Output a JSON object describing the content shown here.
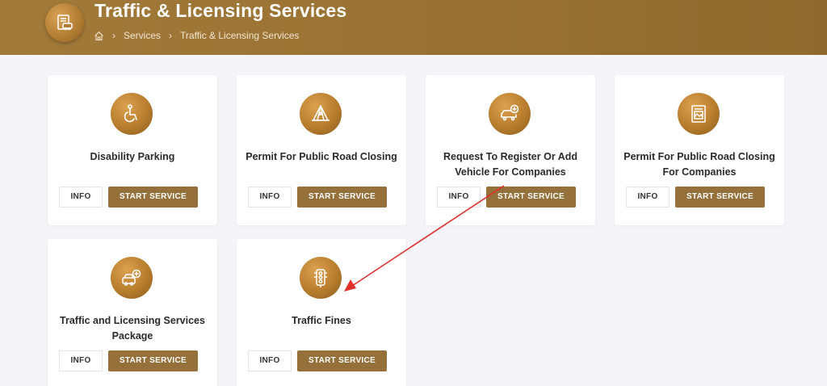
{
  "header": {
    "title": "Traffic & Licensing Services",
    "breadcrumb": {
      "home_icon": "home-icon",
      "items": [
        "Services",
        "Traffic & Licensing Services"
      ],
      "separator": "›"
    },
    "logo_icon": "document-car-icon"
  },
  "colors": {
    "banner": "#9a7233",
    "button": "#96703a",
    "icon_circle": "#b77d2d",
    "background": "#f5f4f8",
    "annotation_arrow": "#e0312a"
  },
  "services": [
    {
      "title": "Disability Parking",
      "icon": "wheelchair-icon",
      "info_label": "INFO",
      "start_label": "START SERVICE"
    },
    {
      "title": "Permit For Public Road Closing",
      "icon": "tent-icon",
      "info_label": "INFO",
      "start_label": "START SERVICE"
    },
    {
      "title": "Request To Register Or Add Vehicle For Companies",
      "icon": "car-add-icon",
      "info_label": "INFO",
      "start_label": "START SERVICE"
    },
    {
      "title": "Permit For Public Road Closing For Companies",
      "icon": "document-image-icon",
      "info_label": "INFO",
      "start_label": "START SERVICE"
    },
    {
      "title": "Traffic and Licensing Services Package",
      "icon": "car-package-icon",
      "info_label": "INFO",
      "start_label": "START SERVICE"
    },
    {
      "title": "Traffic Fines",
      "icon": "traffic-light-icon",
      "info_label": "INFO",
      "start_label": "START SERVICE"
    }
  ],
  "annotation": {
    "type": "arrow",
    "color": "#e0312a",
    "from_card": "Request To Register Or Add Vehicle For Companies",
    "to_card": "Traffic Fines"
  }
}
